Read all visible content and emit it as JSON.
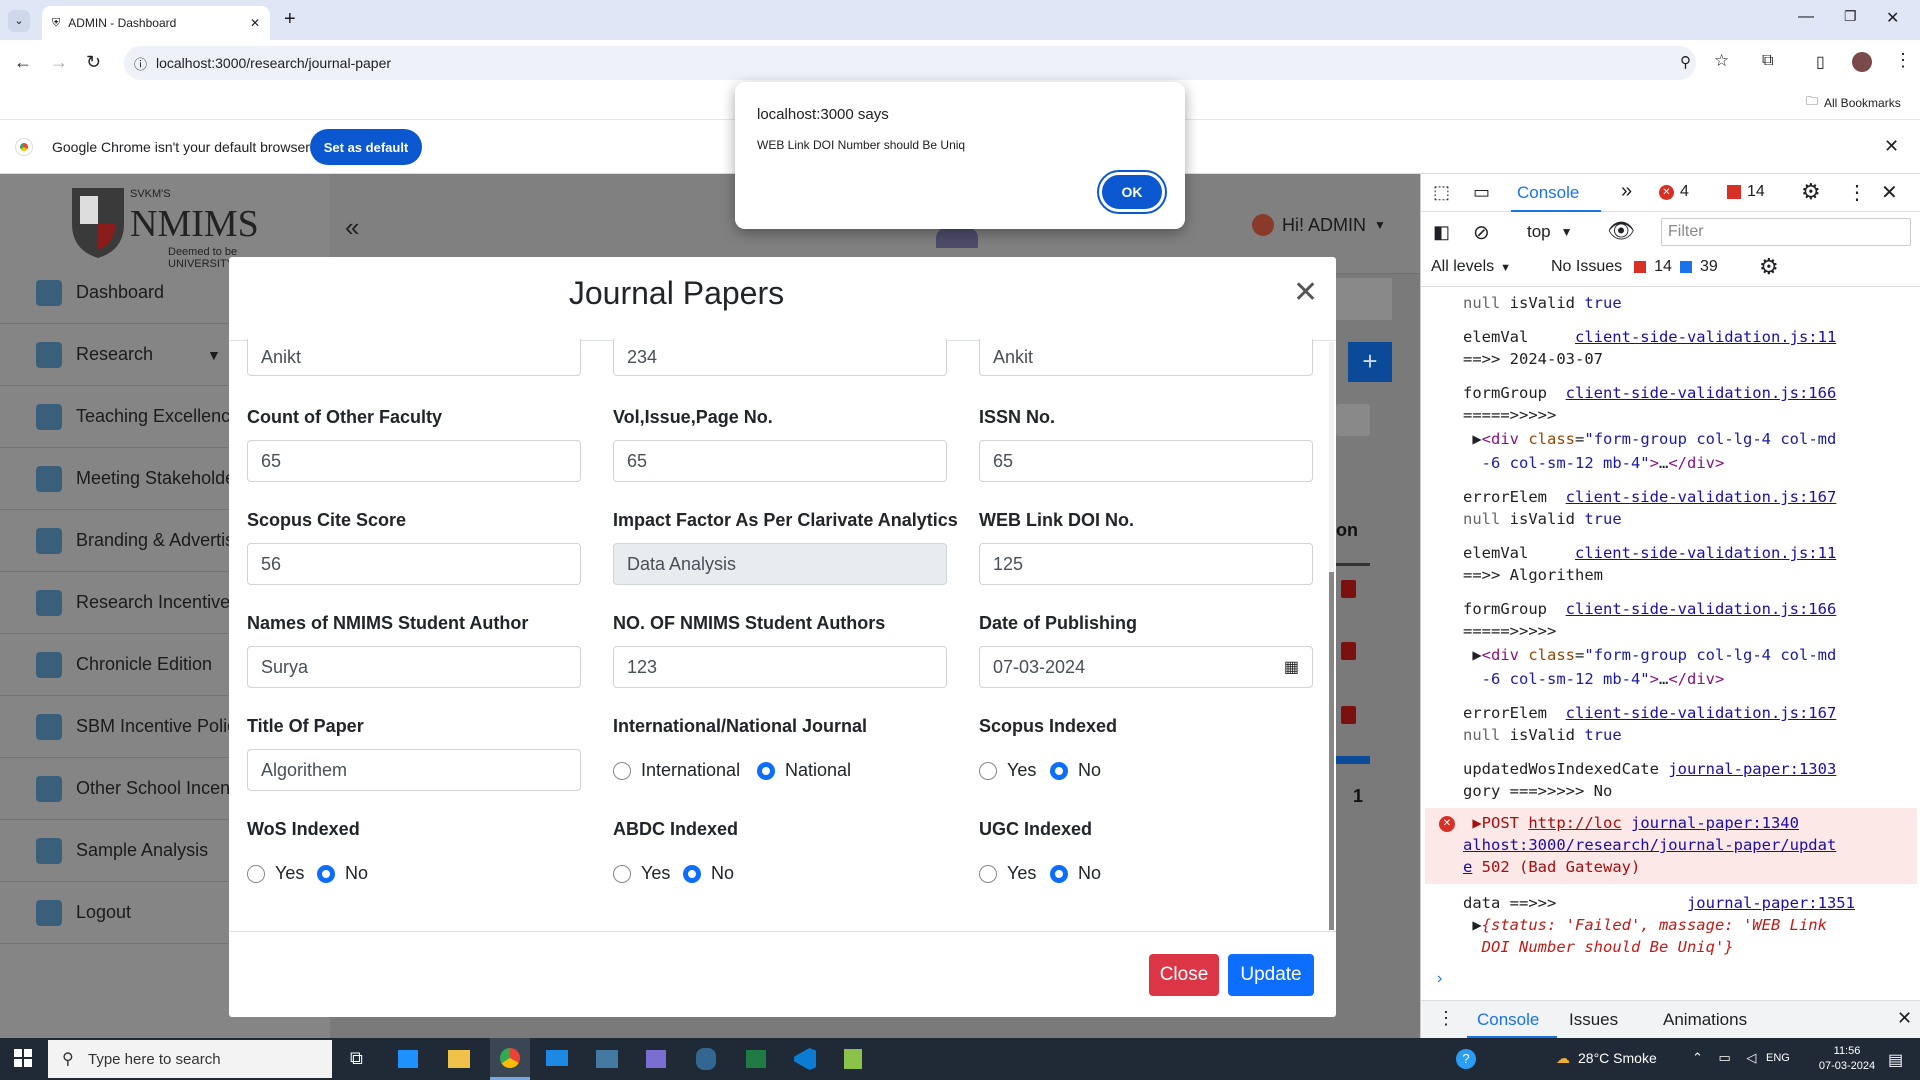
{
  "browser": {
    "tab_title": "ADMIN - Dashboard",
    "url": "localhost:3000/research/journal-paper",
    "all_bookmarks": "All Bookmarks",
    "infobar_text": "Google Chrome isn't your default browser",
    "set_default": "Set as default"
  },
  "alert": {
    "title": "localhost:3000 says",
    "message": "WEB Link DOI Number should Be Uniq",
    "ok": "OK"
  },
  "sidebar": {
    "logo_top": "SVKM'S",
    "logo": "NMIMS",
    "logo_sub": "Deemed to be UNIVERSITY",
    "items": [
      {
        "label": "Dashboard"
      },
      {
        "label": "Research"
      },
      {
        "label": "Teaching Excellence"
      },
      {
        "label": "Meeting Stakeholders"
      },
      {
        "label": "Branding & Advertising"
      },
      {
        "label": "Research Incentive p"
      },
      {
        "label": "Chronicle Edition"
      },
      {
        "label": "SBM Incentive Policy"
      },
      {
        "label": "Other School Incent"
      },
      {
        "label": "Sample Analysis"
      },
      {
        "label": "Logout"
      }
    ]
  },
  "header": {
    "user": "Hi! ADMIN"
  },
  "bg": {
    "col": "on",
    "page_num": "1"
  },
  "modal": {
    "title": "Journal Papers",
    "row0": [
      "Anikt",
      "234",
      "Ankit"
    ],
    "labels1": [
      "Count of Other Faculty",
      "Vol,Issue,Page No.",
      "ISSN No."
    ],
    "row1": [
      "65",
      "65",
      "65"
    ],
    "labels2": [
      "Scopus Cite Score",
      "Impact Factor As Per Clarivate Analytics",
      "WEB Link DOI No."
    ],
    "row2": [
      "56",
      "Data Analysis",
      "125"
    ],
    "labels3": [
      "Names of NMIMS Student Author",
      "NO. OF NMIMS Student Authors",
      "Date of Publishing"
    ],
    "row3": [
      "Surya",
      "123",
      "07-03-2024"
    ],
    "labels4": [
      "Title Of Paper",
      "International/National Journal",
      "Scopus Indexed"
    ],
    "title_value": "Algorithem",
    "opt_international": "International",
    "opt_national": "National",
    "yes": "Yes",
    "no": "No",
    "labels5": [
      "WoS Indexed",
      "ABDC Indexed",
      "UGC Indexed"
    ],
    "close": "Close",
    "update": "Update"
  },
  "devtools": {
    "tab_console": "Console",
    "errors": "4",
    "warnings": "14",
    "top": "top",
    "filter": "Filter",
    "levels": "All levels",
    "no_issues": "No Issues",
    "issues_err": "14",
    "issues_info": "39",
    "drawer": [
      "Console",
      "Issues",
      "Animations"
    ]
  },
  "taskbar": {
    "search": "Type here to search",
    "weather": "28°C  Smoke",
    "lang": "ENG",
    "time": "11:56",
    "date": "07-03-2024"
  }
}
